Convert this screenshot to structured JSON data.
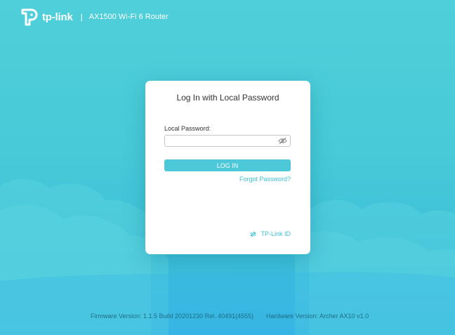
{
  "header": {
    "brand": "tp-link",
    "separator": "|",
    "model": "AX1500 Wi-Fi 6 Router",
    "logo_icon": "tp-link-logo-icon"
  },
  "login_card": {
    "title": "Log In with Local Password",
    "password_label": "Local Password:",
    "password_value": "",
    "password_placeholder": "",
    "eye_icon": "eye-hidden-icon",
    "login_button": "LOG IN",
    "forgot_link": "Forgot Password?",
    "tplink_id_icon": "switch-arrows-icon",
    "tplink_id_link": "TP-Link ID"
  },
  "footer": {
    "firmware": "Firmware Version: 1.1.5 Build 20201230 Rel. 40491(4555)",
    "hardware": "Hardware Version: Archer AX10 v1.0"
  },
  "colors": {
    "background_top": "#4fcfd9",
    "background_bottom": "#35b4e3",
    "accent": "#4cc8d9",
    "link": "#3cbfd5",
    "card": "#ffffff"
  }
}
